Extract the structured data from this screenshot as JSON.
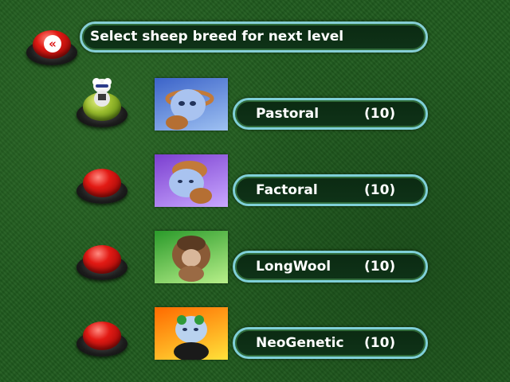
{
  "header": {
    "title": "Select sheep breed for next level"
  },
  "back_button": {
    "icon": "double-chevron-left-icon",
    "glyph": "«"
  },
  "breeds": [
    {
      "name": "Pastoral",
      "count": "(10)",
      "selected": true,
      "thumb_bg": [
        "#3b63c9",
        "#9ec1f2"
      ]
    },
    {
      "name": "Factoral",
      "count": "(10)",
      "selected": false,
      "thumb_bg": [
        "#7b3fd0",
        "#c9a8ff"
      ]
    },
    {
      "name": "LongWool",
      "count": "(10)",
      "selected": false,
      "thumb_bg": [
        "#2a9a2a",
        "#b8f08a"
      ]
    },
    {
      "name": "NeoGenetic",
      "count": "(10)",
      "selected": false,
      "thumb_bg": [
        "#ff6a00",
        "#ffe23a"
      ]
    }
  ],
  "colors": {
    "pill_border": "#7fd0d8",
    "pill_fill": "#0b2a12",
    "button_red": "#e21a14",
    "button_selected": "#9bbd2e"
  }
}
